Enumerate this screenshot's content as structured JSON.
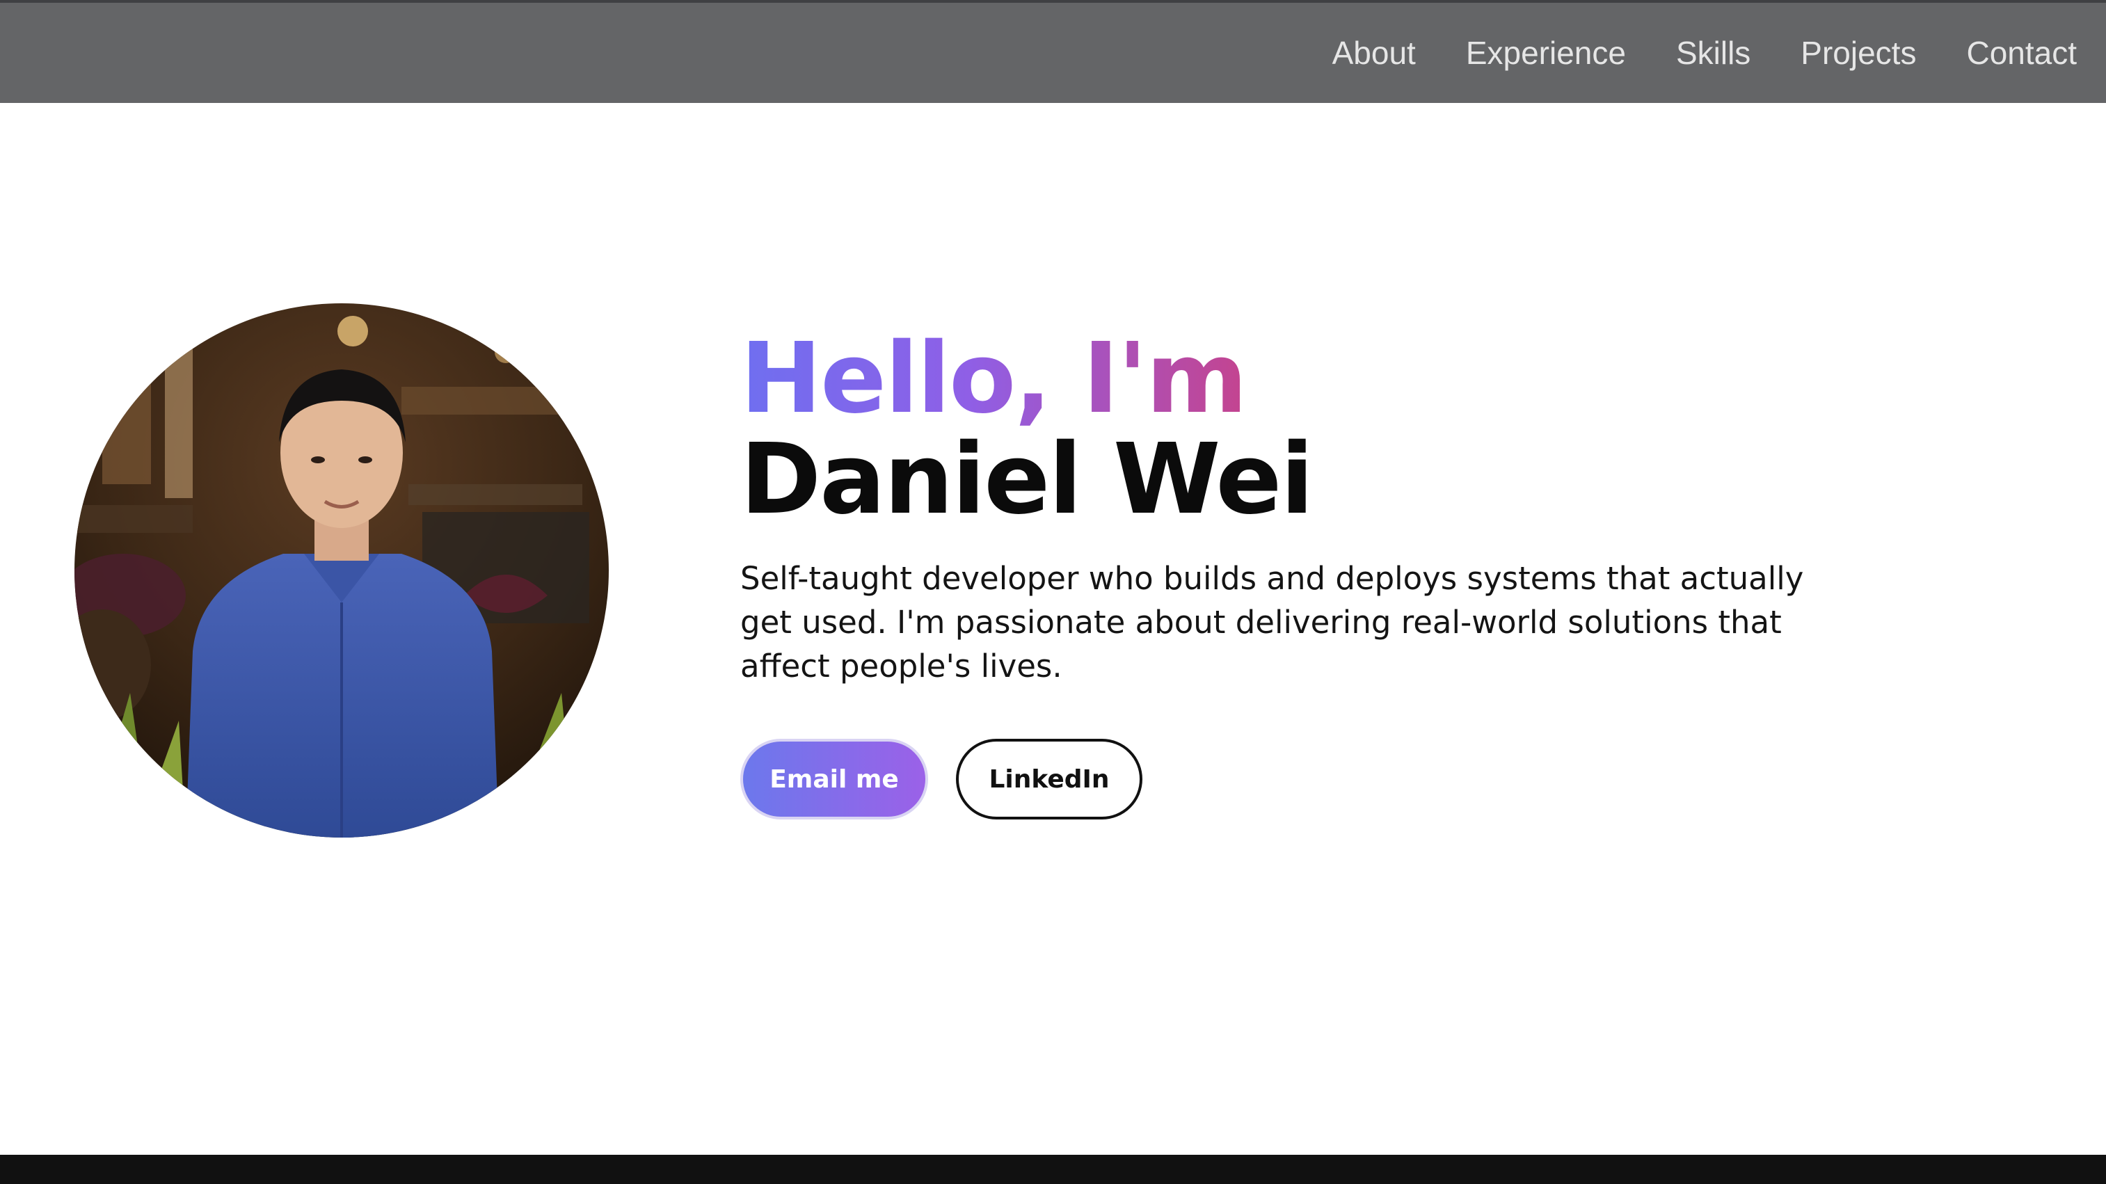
{
  "nav": {
    "links": [
      "About",
      "Experience",
      "Skills",
      "Projects",
      "Contact"
    ]
  },
  "hero": {
    "greeting": "Hello, I'm",
    "name": "Daniel Wei",
    "bio": "Self-taught developer who builds and deploys systems that actually get used. I'm passionate about delivering real-world solutions that affect people's lives.",
    "buttons": {
      "email": "Email me",
      "linkedin": "LinkedIn"
    }
  },
  "colors": {
    "nav_bg": "#646567",
    "greeting_gradient": [
      "#6f6ff0",
      "#8f5fe6",
      "#c4448f"
    ],
    "primary_button_gradient": [
      "#6c78ec",
      "#9b61e8"
    ],
    "footer_bg": "#111111"
  }
}
